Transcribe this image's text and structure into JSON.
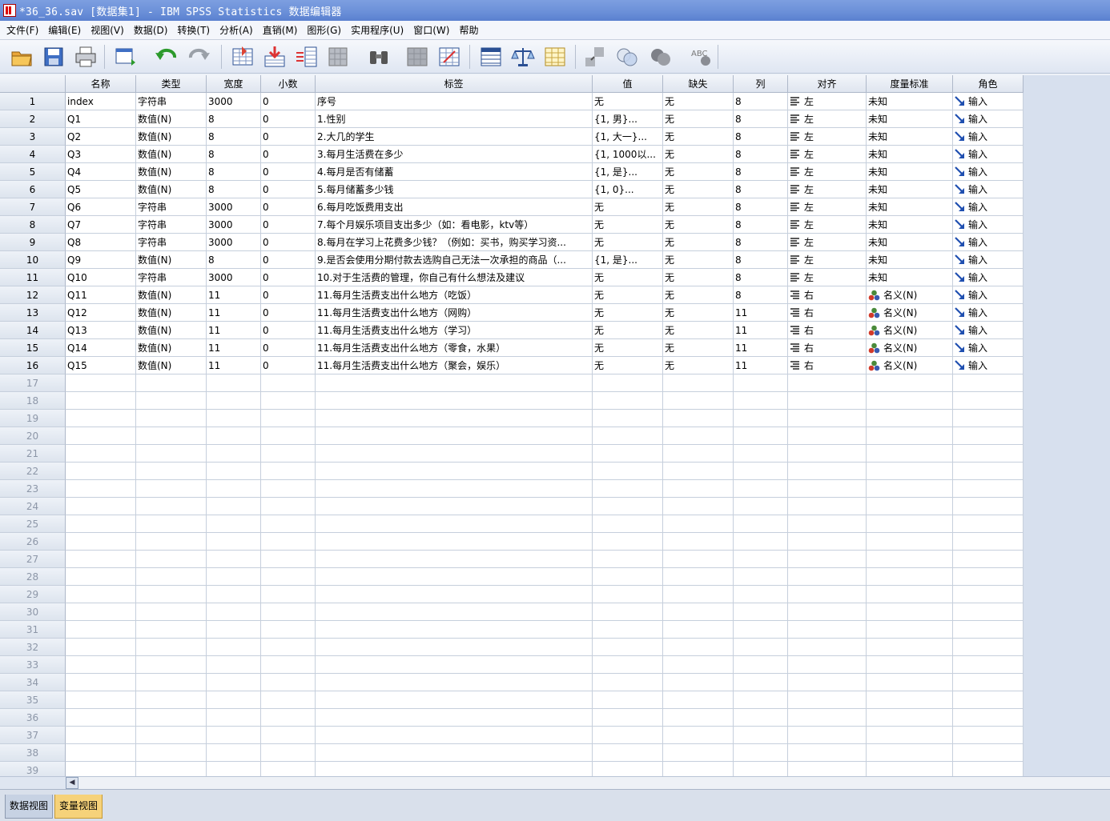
{
  "window": {
    "title": "*36_36.sav [数据集1] - IBM SPSS Statistics 数据编辑器"
  },
  "menu": [
    "文件(F)",
    "编辑(E)",
    "视图(V)",
    "数据(D)",
    "转换(T)",
    "分析(A)",
    "直销(M)",
    "图形(G)",
    "实用程序(U)",
    "窗口(W)",
    "帮助"
  ],
  "toolbar": {
    "items": [
      "open-icon",
      "save-icon",
      "print-icon",
      "recall-dialog-icon",
      "undo-icon",
      "redo-icon",
      "goto-case-icon",
      "goto-variable-icon",
      "variables-icon",
      "find-icon",
      "binoculars-icon",
      "insert-cases-icon",
      "insert-variable-icon",
      "split-file-icon",
      "weight-cases-icon",
      "select-cases-icon",
      "value-labels-icon",
      "use-sets-icon",
      "show-all-variables-icon",
      "spell-check-icon"
    ],
    "spell_label": "ABC"
  },
  "columns": [
    "名称",
    "类型",
    "宽度",
    "小数",
    "标签",
    "值",
    "缺失",
    "列",
    "对齐",
    "度量标准",
    "角色"
  ],
  "rows": [
    {
      "n": "1",
      "name": "index",
      "type": "字符串",
      "width": "3000",
      "dec": "0",
      "label": "序号",
      "values": "无",
      "missing": "无",
      "cols": "8",
      "align": "左",
      "measure": "未知",
      "role": "输入"
    },
    {
      "n": "2",
      "name": "Q1",
      "type": "数值(N)",
      "width": "8",
      "dec": "0",
      "label": "1.性别",
      "values": "{1, 男}...",
      "missing": "无",
      "cols": "8",
      "align": "左",
      "measure": "未知",
      "role": "输入"
    },
    {
      "n": "3",
      "name": "Q2",
      "type": "数值(N)",
      "width": "8",
      "dec": "0",
      "label": "2.大几的学生",
      "values": "{1, 大一}...",
      "missing": "无",
      "cols": "8",
      "align": "左",
      "measure": "未知",
      "role": "输入"
    },
    {
      "n": "4",
      "name": "Q3",
      "type": "数值(N)",
      "width": "8",
      "dec": "0",
      "label": "3.每月生活费在多少",
      "values": "{1, 1000以...",
      "missing": "无",
      "cols": "8",
      "align": "左",
      "measure": "未知",
      "role": "输入"
    },
    {
      "n": "5",
      "name": "Q4",
      "type": "数值(N)",
      "width": "8",
      "dec": "0",
      "label": "4.每月是否有储蓄",
      "values": "{1, 是}...",
      "missing": "无",
      "cols": "8",
      "align": "左",
      "measure": "未知",
      "role": "输入"
    },
    {
      "n": "6",
      "name": "Q5",
      "type": "数值(N)",
      "width": "8",
      "dec": "0",
      "label": "5.每月储蓄多少钱",
      "values": "{1, 0}...",
      "missing": "无",
      "cols": "8",
      "align": "左",
      "measure": "未知",
      "role": "输入"
    },
    {
      "n": "7",
      "name": "Q6",
      "type": "字符串",
      "width": "3000",
      "dec": "0",
      "label": "6.每月吃饭费用支出",
      "values": "无",
      "missing": "无",
      "cols": "8",
      "align": "左",
      "measure": "未知",
      "role": "输入"
    },
    {
      "n": "8",
      "name": "Q7",
      "type": "字符串",
      "width": "3000",
      "dec": "0",
      "label": "7.每个月娱乐项目支出多少（如：看电影，ktv等）",
      "values": "无",
      "missing": "无",
      "cols": "8",
      "align": "左",
      "measure": "未知",
      "role": "输入"
    },
    {
      "n": "9",
      "name": "Q8",
      "type": "字符串",
      "width": "3000",
      "dec": "0",
      "label": "8.每月在学习上花费多少钱？（例如：买书，购买学习资...",
      "values": "无",
      "missing": "无",
      "cols": "8",
      "align": "左",
      "measure": "未知",
      "role": "输入"
    },
    {
      "n": "10",
      "name": "Q9",
      "type": "数值(N)",
      "width": "8",
      "dec": "0",
      "label": "9.是否会使用分期付款去选购自己无法一次承担的商品（...",
      "values": "{1, 是}...",
      "missing": "无",
      "cols": "8",
      "align": "左",
      "measure": "未知",
      "role": "输入"
    },
    {
      "n": "11",
      "name": "Q10",
      "type": "字符串",
      "width": "3000",
      "dec": "0",
      "label": "10.对于生活费的管理，你自己有什么想法及建议",
      "values": "无",
      "missing": "无",
      "cols": "8",
      "align": "左",
      "measure": "未知",
      "role": "输入"
    },
    {
      "n": "12",
      "name": "Q11",
      "type": "数值(N)",
      "width": "11",
      "dec": "0",
      "label": "11.每月生活费支出什么地方（吃饭）",
      "values": "无",
      "missing": "无",
      "cols": "8",
      "align": "右",
      "measure": "名义(N)",
      "role": "输入"
    },
    {
      "n": "13",
      "name": "Q12",
      "type": "数值(N)",
      "width": "11",
      "dec": "0",
      "label": "11.每月生活费支出什么地方（网购）",
      "values": "无",
      "missing": "无",
      "cols": "11",
      "align": "右",
      "measure": "名义(N)",
      "role": "输入"
    },
    {
      "n": "14",
      "name": "Q13",
      "type": "数值(N)",
      "width": "11",
      "dec": "0",
      "label": "11.每月生活费支出什么地方（学习）",
      "values": "无",
      "missing": "无",
      "cols": "11",
      "align": "右",
      "measure": "名义(N)",
      "role": "输入"
    },
    {
      "n": "15",
      "name": "Q14",
      "type": "数值(N)",
      "width": "11",
      "dec": "0",
      "label": "11.每月生活费支出什么地方（零食，水果）",
      "values": "无",
      "missing": "无",
      "cols": "11",
      "align": "右",
      "measure": "名义(N)",
      "role": "输入"
    },
    {
      "n": "16",
      "name": "Q15",
      "type": "数值(N)",
      "width": "11",
      "dec": "0",
      "label": "11.每月生活费支出什么地方（聚会，娱乐）",
      "values": "无",
      "missing": "无",
      "cols": "11",
      "align": "右",
      "measure": "名义(N)",
      "role": "输入"
    }
  ],
  "empty_row_numbers": [
    "17",
    "18",
    "19",
    "20",
    "21",
    "22",
    "23",
    "24",
    "25",
    "26",
    "27",
    "28",
    "29",
    "30",
    "31",
    "32",
    "33",
    "34",
    "35",
    "36",
    "37",
    "38",
    "39"
  ],
  "tabs": {
    "data_view": "数据视图",
    "variable_view": "变量视图",
    "active": "变量视图"
  },
  "colors": {
    "title_bar": "#6a8fd8",
    "active_tab": "#f6d27a",
    "grid_line": "#c6cfdc",
    "row_header": "#dde4ee"
  }
}
